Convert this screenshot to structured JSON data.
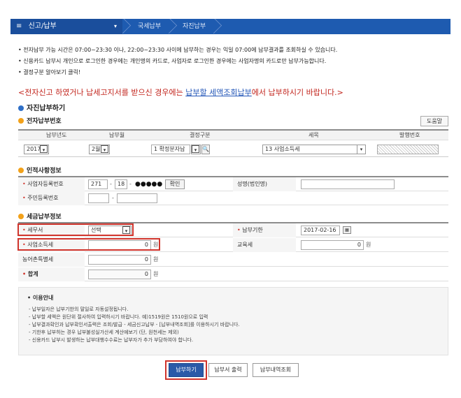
{
  "nav": {
    "menu_label": "신고/납부",
    "crumbs": [
      "국세납부",
      "자진납부"
    ]
  },
  "notices": [
    "전자납부 가능 시간은 07:00~23:30 이나, 22:00~23:30 사이에 납부하는 경우는 익일 07:00에 납부결과를 조회하실 수 있습니다.",
    "신용카드 납부시 개인으로 로그인한 경우에는 개인명의 카드로, 사업자로 로그인한 경우에는 사업자명의 카드로만 납부가능합니다.",
    "결정구분 알아보기 클릭!"
  ],
  "red_message": {
    "before": "<전자신고 하였거나 납세고지서를 받으신 경우에는 ",
    "link": "납부할 세액조회납부",
    "after": "에서 납부하시기 바랍니다.>"
  },
  "section_main": "자진납부하기",
  "section_epay": "전자납부번호",
  "help_button": "도움말",
  "grid": {
    "headers": [
      "납부년도",
      "납부월",
      "결정구분",
      "세목",
      "발행번호"
    ],
    "year": "2017",
    "month": "2월",
    "decision": "1 확정분자납",
    "tax_item": "13 사업소득세"
  },
  "section_taxpayer": "인적사항정보",
  "taxpayer": {
    "bizno_label": "사업자등록번호",
    "bizno_1": "271",
    "bizno_2": "18",
    "bizno_masked": "●●●●●",
    "confirm_button": "확인",
    "name_label": "성명(법인명)",
    "resident_label": "주민등록번호",
    "dash": "-"
  },
  "section_tax": "세금납부정보",
  "tax": {
    "office_label": "세무서",
    "office_value": "선택",
    "due_label": "납부기한",
    "due_value": "2017-02-16",
    "cal_icon": "calendar",
    "bizincome_label": "사업소득세",
    "bizincome_value": "0",
    "edu_label": "교육세",
    "edu_value": "0",
    "rural_label": "농어촌특별세",
    "rural_value": "0",
    "total_label": "합계",
    "total_value": "0",
    "won": "원"
  },
  "usage": {
    "title": "이용안내",
    "items": [
      "납부일자은 납부기한의 말일로 자동설정됩니다.",
      "납부할 세액은 원단위 절사하여 입력하시기 바랍니다. 예)1519원은 1510원으로 입력",
      "납부결과확인과 납부확인서출력은 조회/발급 - 세금신고납부 - [납부내역조회]를 이용하시기 바랍니다.",
      "기한후 납부하는 경우 납부불성실가산세 계산예보기 (단, 원천세는 제외)",
      "신용카드 납부시 발생하는 납부대행수수료는 납부자가 추가 부담하여야 합니다."
    ],
    "link1": "[납부내역조회]",
    "link2": "납부불성실가산세 계산예보기"
  },
  "buttons": {
    "pay": "납부하기",
    "print": "납부서 출력",
    "history": "납부내역조회"
  },
  "colors": {
    "nav_blue": "#1e5bb0",
    "highlight_red": "#d0342c",
    "primary_button": "#2a5aa8"
  }
}
